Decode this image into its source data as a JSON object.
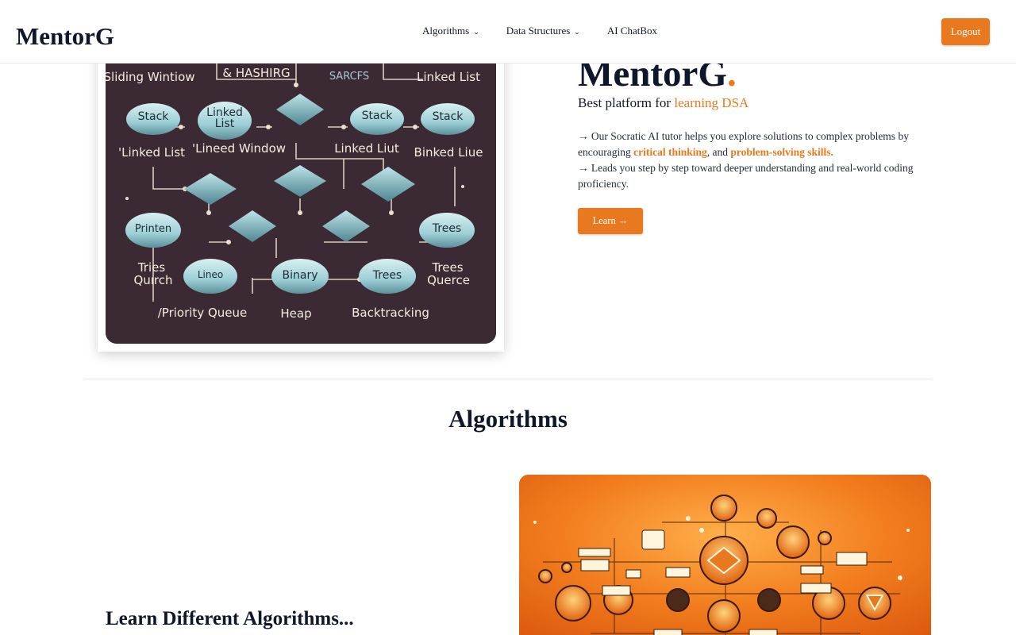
{
  "navbar": {
    "brand": "MentorG",
    "links": [
      {
        "label": "Algorithms",
        "has_dropdown": true
      },
      {
        "label": "Data Structures",
        "has_dropdown": true
      },
      {
        "label": "AI ChatBox",
        "has_dropdown": false
      }
    ],
    "logout_label": "Logout"
  },
  "hero": {
    "title": "MentorG",
    "title_dot": ".",
    "subtitle_prefix": "Best platform for ",
    "subtitle_accent": "learning DSA",
    "desc_line1_prefix": "→ Our Socratic AI tutor helps you explore solutions to complex problems by encouraging ",
    "desc_line1_bold1": "critical thinking",
    "desc_line1_mid": ", and ",
    "desc_line1_bold2": "problem-solving skills.",
    "desc_line2": "→ Leads you step by step toward deeper understanding and real-world coding proficiency.",
    "learn_label": "Learn →",
    "image_labels": {
      "top_left": "Sliding Wintiow",
      "top_mid": "& HASHIRG",
      "top_mid2": "SARCFS",
      "top_right": "Linked List",
      "n_stack1": "Stack",
      "n_linked1a": "Linked",
      "n_linked1b": "List",
      "n_stack2": "Stack",
      "n_stack3": "Stack",
      "l_linked": "'Linked List",
      "l_window": "'Lineed Window",
      "l_linkedliut": "Linked Liut",
      "l_binked": "Binked Liue",
      "n_printen": "Printen",
      "n_trees1": "Trees",
      "l_tries1": "Tries",
      "l_tries2": "Quırch",
      "n_lineo": "Lineo",
      "n_binary": "Binary",
      "n_trees2": "Trees",
      "l_trees1": "Trees",
      "l_trees2": "Querce",
      "l_pq": "/Priority Queue",
      "l_heap": "Heap",
      "l_backtracking": "Backtracking"
    }
  },
  "algorithms": {
    "section_title": "Algorithms",
    "heading": "Learn Different Algorithms..."
  },
  "colors": {
    "accent": "#e8791e",
    "dark": "#0f172a",
    "hero_image_bg": "#3b2a33"
  }
}
